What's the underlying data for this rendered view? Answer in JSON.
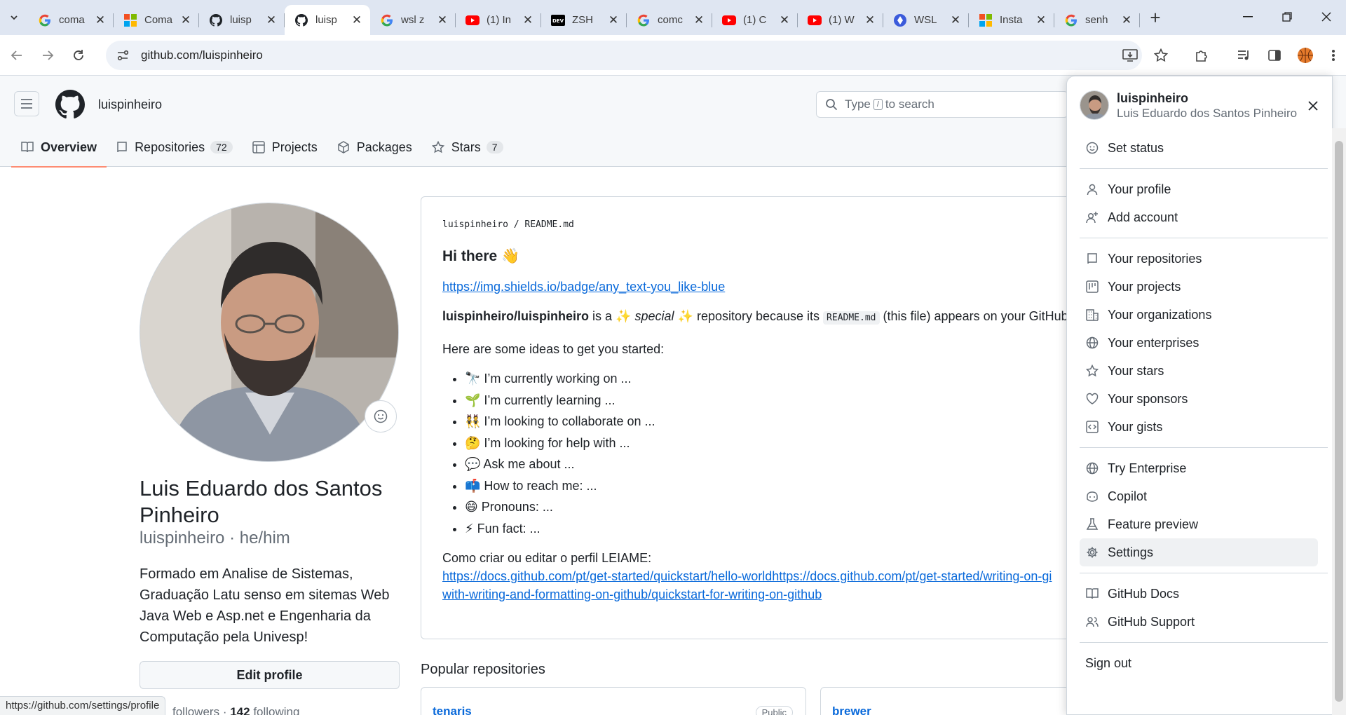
{
  "browser": {
    "tabs": [
      {
        "title": "coma",
        "icon": "google-icon"
      },
      {
        "title": "Coma",
        "icon": "microsoft-icon"
      },
      {
        "title": "luisp",
        "icon": "github-icon"
      },
      {
        "title": "luisp",
        "icon": "github-icon",
        "active": true
      },
      {
        "title": "wsl z",
        "icon": "google-icon"
      },
      {
        "title": "(1) In",
        "icon": "youtube-icon"
      },
      {
        "title": "ZSH",
        "icon": "dev-icon"
      },
      {
        "title": "comc",
        "icon": "google-icon"
      },
      {
        "title": "(1) C",
        "icon": "youtube-icon"
      },
      {
        "title": "(1) W",
        "icon": "youtube-icon"
      },
      {
        "title": "WSL",
        "icon": "wsl-icon"
      },
      {
        "title": "Insta",
        "icon": "microsoft-icon"
      },
      {
        "title": "senh",
        "icon": "google-icon"
      }
    ],
    "new_tab": "+",
    "url": "github.com/luispinheiro",
    "status_url": "https://github.com/settings/profile"
  },
  "header": {
    "owner": "luispinheiro",
    "search_pre": "Type",
    "search_key": "/",
    "search_post": "to search"
  },
  "nav": {
    "overview": "Overview",
    "repositories": "Repositories",
    "repositories_count": "72",
    "projects": "Projects",
    "packages": "Packages",
    "stars": "Stars",
    "stars_count": "7"
  },
  "profile": {
    "name": "Luis Eduardo dos Santos Pinheiro",
    "login": "luispinheiro · he/him",
    "bio": "Formado em Analise de Sistemas, Graduação Latu senso em sitemas Web Java Web e Asp.net e Engenharia da Computação pela Univesp!",
    "edit": "Edit profile",
    "followers_count": "",
    "followers_label": "followers",
    "following_count": "142",
    "following_label": "following"
  },
  "readme": {
    "path_user": "luispinheiro",
    "path_sep": "/",
    "path_file": "README.md",
    "heading": "Hi there 👋",
    "badge_link": "https://img.shields.io/badge/any_text-you_like-blue",
    "intro_bold": "luispinheiro/luispinheiro",
    "intro_a": "is a ✨",
    "intro_em": "special",
    "intro_b": "✨ repository because its",
    "intro_code": "README.md",
    "intro_c": "(this file) appears on your GitHub pro",
    "ideas": "Here are some ideas to get you started:",
    "items": [
      "🔭 I’m currently working on ...",
      "🌱 I’m currently learning ...",
      "👯 I’m looking to collaborate on ...",
      "🤔 I’m looking for help with ...",
      "💬 Ask me about ...",
      "📫 How to reach me: ...",
      "😄 Pronouns: ...",
      "⚡ Fun fact: ..."
    ],
    "create_text": "Como criar ou editar o perfil LEIAME:",
    "link_line1": "https://docs.github.com/pt/get-started/quickstart/hello-worldhttps://docs.github.com/pt/get-started/writing-on-gi",
    "link_line2": "with-writing-and-formatting-on-github/quickstart-for-writing-on-github"
  },
  "popular": {
    "title": "Popular repositories",
    "repos": [
      {
        "name": "tenaris",
        "visibility": "Public"
      },
      {
        "name": "brewer"
      }
    ]
  },
  "menu": {
    "username": "luispinheiro",
    "fullname": "Luis Eduardo dos Santos Pinheiro",
    "groups": [
      [
        {
          "label": "Set status",
          "icon": "smiley-icon"
        }
      ],
      [
        {
          "label": "Your profile",
          "icon": "person-icon"
        },
        {
          "label": "Add account",
          "icon": "person-add-icon"
        }
      ],
      [
        {
          "label": "Your repositories",
          "icon": "repo-icon"
        },
        {
          "label": "Your projects",
          "icon": "project-icon"
        },
        {
          "label": "Your organizations",
          "icon": "organization-icon"
        },
        {
          "label": "Your enterprises",
          "icon": "globe-icon"
        },
        {
          "label": "Your stars",
          "icon": "star-icon"
        },
        {
          "label": "Your sponsors",
          "icon": "heart-icon"
        },
        {
          "label": "Your gists",
          "icon": "code-square-icon"
        }
      ],
      [
        {
          "label": "Try Enterprise",
          "icon": "globe-icon"
        },
        {
          "label": "Copilot",
          "icon": "copilot-icon"
        },
        {
          "label": "Feature preview",
          "icon": "beaker-icon"
        },
        {
          "label": "Settings",
          "icon": "gear-icon",
          "highlighted": true
        }
      ],
      [
        {
          "label": "GitHub Docs",
          "icon": "book-icon"
        },
        {
          "label": "GitHub Support",
          "icon": "people-icon"
        }
      ],
      [
        {
          "label": "Sign out",
          "icon": ""
        }
      ]
    ]
  },
  "colors": {
    "link": "#0969da",
    "tab_active_underline": "#fd8c73",
    "menu_highlight": "#eff1f3"
  }
}
